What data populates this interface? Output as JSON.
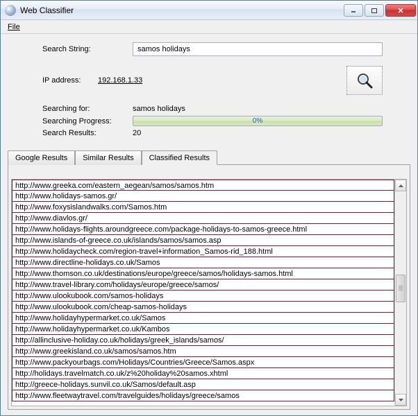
{
  "window": {
    "title": "Web Classifier"
  },
  "menu": {
    "file": "File"
  },
  "form": {
    "search_label": "Search String:",
    "search_value": "samos holidays",
    "ip_label": "IP address:",
    "ip_value": "192.168.1.33"
  },
  "status": {
    "searching_for_label": "Searching for:",
    "searching_for_value": "samos holidays",
    "progress_label": "Searching Progress:",
    "progress_pct": "0%",
    "results_label": "Search Results:",
    "results_value": "20"
  },
  "tabs": {
    "google": "Google Results",
    "similar": "Similar Results",
    "classified": "Classified Results"
  },
  "results": [
    "http://www.greeka.com/eastern_aegean/samos/samos.htm",
    "http://www.holidays-samos.gr/",
    "http://www.foxysislandwalks.com/Samos.htm",
    "http://www.diavlos.gr/",
    "http://www.holidays-flights.aroundgreece.com/package-holidays-to-samos-greece.html",
    "http://www.islands-of-greece.co.uk/islands/samos/samos.asp",
    "http://www.holidaycheck.com/region-travel+information_Samos-rid_188.html",
    "http://www.directline-holidays.co.uk/Samos",
    "http://www.thomson.co.uk/destinations/europe/greece/samos/holidays-samos.html",
    "http://www.travel-library.com/holidays/europe/greece/samos/",
    "http://www.ulookubook.com/samos-holidays",
    "http://www.ulookubook.com/cheap-samos-holidays",
    "http://www.holidayhypermarket.co.uk/Samos",
    "http://www.holidayhypermarket.co.uk/Kambos",
    "http://allinclusive-holiday.co.uk/holidays/greek_islands/samos/",
    "http://www.greekisland.co.uk/samos/samos.htm",
    "http://www.packyourbags.com/Holidays/Countries/Greece/Samos.aspx",
    "http://holidays.travelmatch.co.uk/z%20holiday%20samos.xhtml",
    "http://greece-holidays.sunvil.co.uk/Samos/default.asp",
    "http://www.fleetwaytravel.com/travelguides/holidays/greece/samos"
  ]
}
